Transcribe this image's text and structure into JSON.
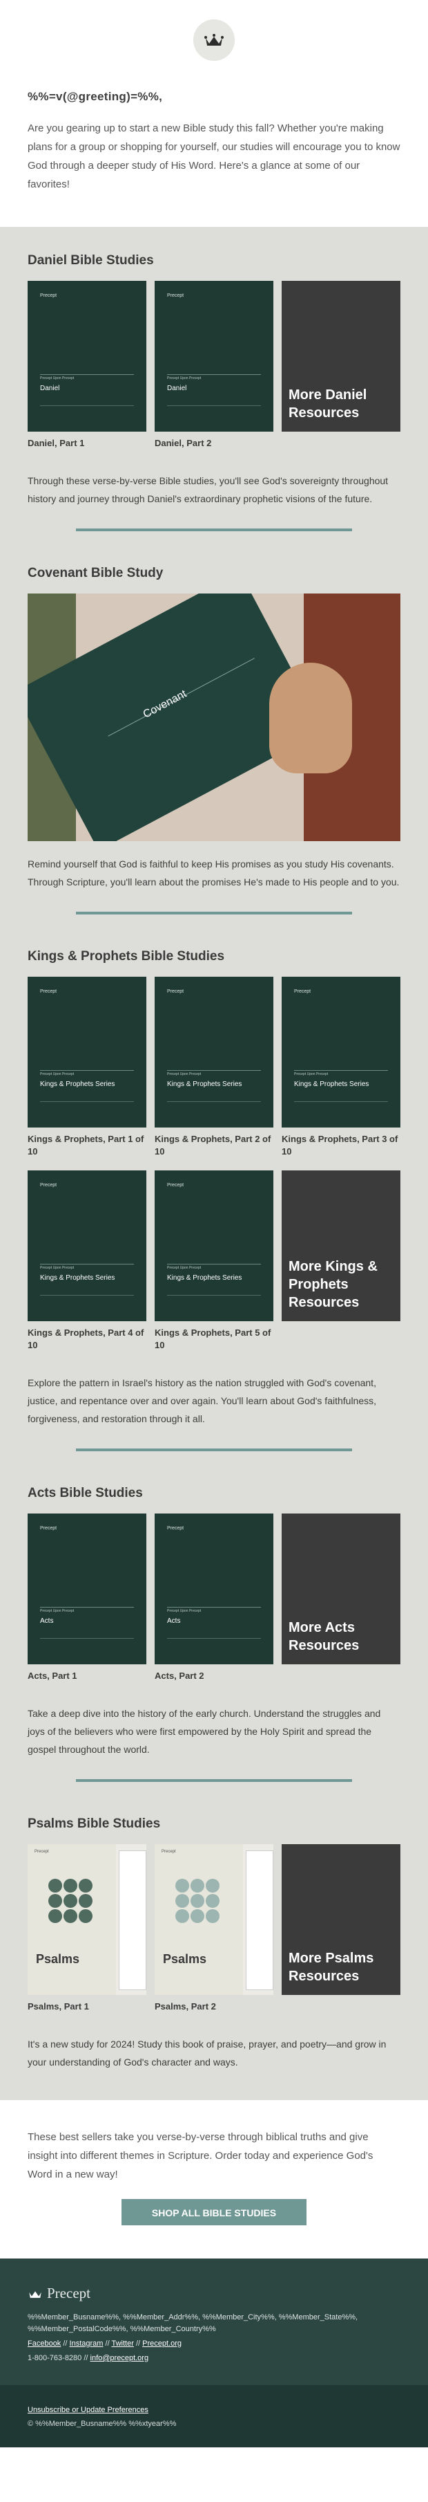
{
  "header": {
    "logo_icon": "crown-icon",
    "greeting": "%%=v(@greeting)=%%,",
    "intro": "Are you gearing up to start a new Bible study this fall? Whether you're making plans for a group or shopping for yourself, our studies will encourage you to know God through a deeper study of His Word. Here's a glance at some of our favorites!"
  },
  "cover_text": {
    "brand": "Precept",
    "series_label": "Precept Upon Precept"
  },
  "daniel": {
    "title": "Daniel Bible Studies",
    "covers": [
      {
        "cover_title": "Daniel",
        "caption": "Daniel, Part 1"
      },
      {
        "cover_title": "Daniel",
        "caption": "Daniel, Part 2"
      }
    ],
    "more": "More Daniel Resources",
    "description": "Through these verse-by-verse Bible studies, you'll see God's sovereignty throughout history and journey through Daniel's extraordinary prophetic visions of the future."
  },
  "covenant": {
    "title": "Covenant Bible Study",
    "cover_title": "Covenant",
    "description": "Remind yourself that God is faithful to keep His promises as you study His covenants. Through Scripture, you'll learn about the promises He's made to His people and to you."
  },
  "kings": {
    "title": "Kings & Prophets Bible Studies",
    "covers": [
      {
        "cover_title": "Kings & Prophets Series",
        "caption": "Kings & Prophets, Part 1 of 10"
      },
      {
        "cover_title": "Kings & Prophets Series",
        "caption": "Kings & Prophets, Part 2 of 10"
      },
      {
        "cover_title": "Kings & Prophets Series",
        "caption": "Kings & Prophets, Part 3 of 10"
      },
      {
        "cover_title": "Kings & Prophets Series",
        "caption": "Kings & Prophets, Part 4 of 10"
      },
      {
        "cover_title": "Kings & Prophets Series",
        "caption": "Kings & Prophets, Part 5 of 10"
      }
    ],
    "more": "More Kings & Prophets Resources",
    "description": "Explore the pattern in Israel's history as the nation struggled with God's covenant, justice, and repentance over and over again. You'll learn about God's faithfulness, forgiveness, and restoration through it all."
  },
  "acts": {
    "title": "Acts Bible Studies",
    "covers": [
      {
        "cover_title": "Acts",
        "caption": "Acts, Part 1"
      },
      {
        "cover_title": "Acts",
        "caption": "Acts, Part 2"
      }
    ],
    "more": "More Acts Resources",
    "description": "Take a deep dive into the history of the early church. Understand the struggles and joys of the believers who were first empowered by the Holy Spirit and spread the gospel throughout the world."
  },
  "psalms": {
    "title": "Psalms Bible Studies",
    "covers": [
      {
        "cover_title": "Psalms",
        "caption": "Psalms, Part 1",
        "dot_color": "#4f6b60"
      },
      {
        "cover_title": "Psalms",
        "caption": "Psalms, Part 2",
        "dot_color": "#9cb5b1"
      }
    ],
    "more": "More Psalms Resources",
    "description": "It's a new study for 2024! Study this book of praise, prayer, and poetry—and grow in your understanding of God's character and ways."
  },
  "cta": {
    "text": "These best sellers take you verse-by-verse through biblical truths and give insight into different themes in Scripture. Order today and experience God's Word in a new way!",
    "button": "SHOP ALL BIBLE STUDIES"
  },
  "footer": {
    "logo": "Precept",
    "address1": "%%Member_Busname%%, %%Member_Addr%%, %%Member_City%%, %%Member_State%%,",
    "address2": "%%Member_PostalCode%%, %%Member_Country%%",
    "links": [
      "Facebook",
      "Instagram",
      "Twitter",
      "Precept.org"
    ],
    "sep": " // ",
    "phone": "1-800-763-8280",
    "email": "info@precept.org",
    "unsubscribe": "Unsubscribe or Update Preferences",
    "copyright": "© %%Member_Busname%% %%xtyear%%"
  },
  "colors": {
    "accent": "#6f9895",
    "cover_green": "#1f3a33",
    "more_dark": "#3b3b3b",
    "footer": "#2c4641"
  }
}
